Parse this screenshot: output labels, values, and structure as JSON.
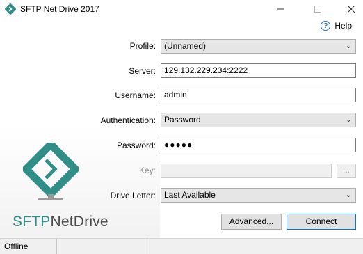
{
  "window": {
    "title": "SFTP Net Drive 2017",
    "icon": "sftp-app-icon"
  },
  "controls": {
    "minimize": "minimize-icon",
    "maximize": "maximize-icon",
    "close": "close-icon"
  },
  "help": {
    "label": "Help",
    "icon": "help-icon"
  },
  "form": {
    "profile": {
      "label": "Profile:",
      "value": "(Unnamed)"
    },
    "server": {
      "label": "Server:",
      "value": "129.132.229.234:2222"
    },
    "username": {
      "label": "Username:",
      "value": "admin"
    },
    "authentication": {
      "label": "Authentication:",
      "value": "Password"
    },
    "password": {
      "label": "Password:",
      "value": "●●●●●"
    },
    "key": {
      "label": "Key:",
      "value": "",
      "browse": "..."
    },
    "drive_letter": {
      "label": "Drive Letter:",
      "value": "Last Available"
    }
  },
  "buttons": {
    "advanced": "Advanced...",
    "connect": "Connect"
  },
  "brand": {
    "part1": "SFTP",
    "part2": "NetDrive"
  },
  "status": {
    "connection": "Offline"
  },
  "colors": {
    "accent": "#2f8e88",
    "brand_dark": "#1f6f6a"
  }
}
